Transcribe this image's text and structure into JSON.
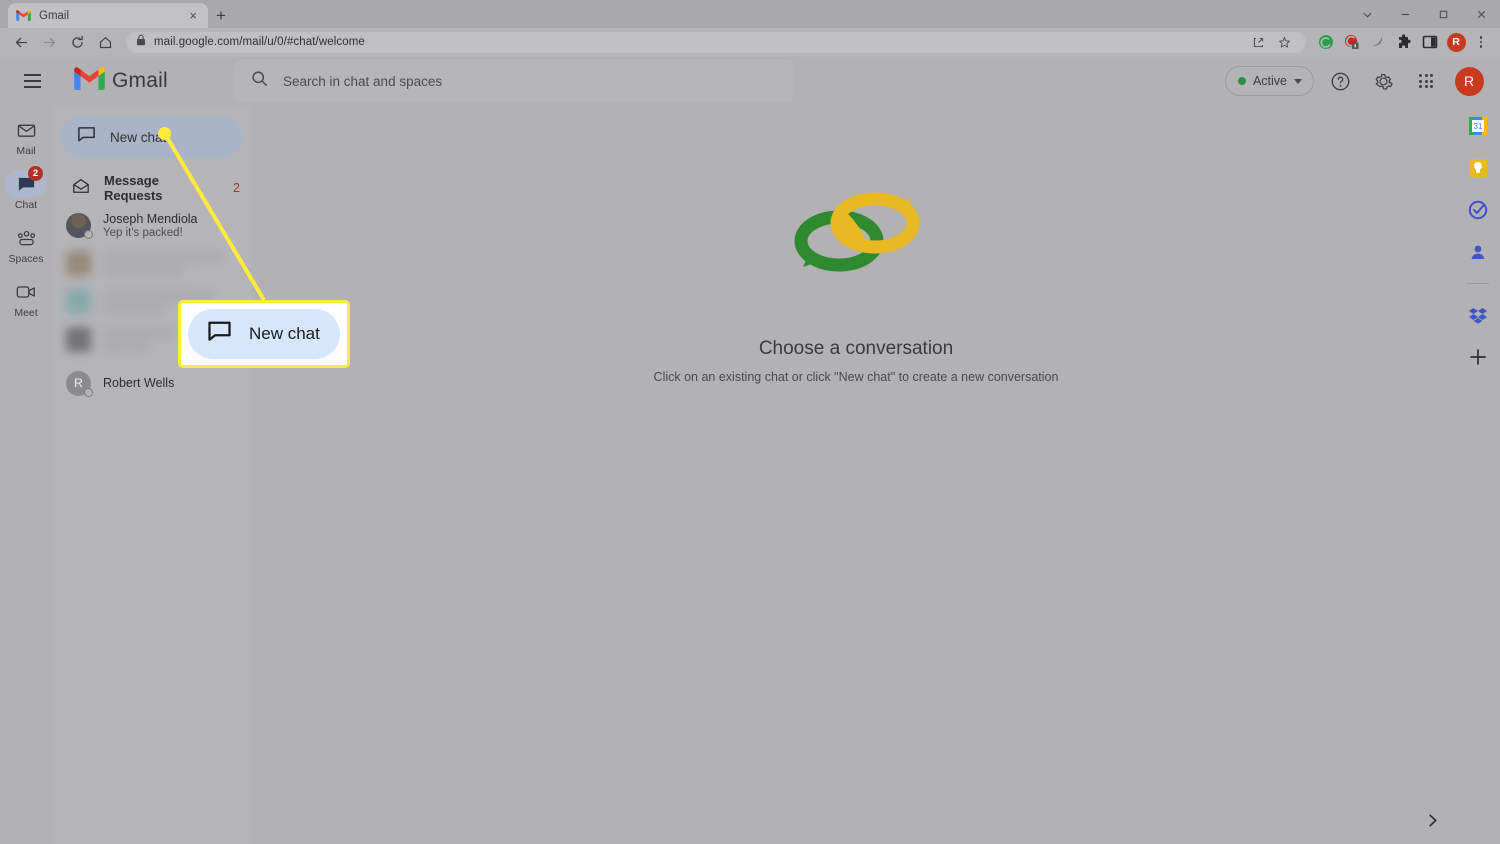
{
  "browser": {
    "tab": {
      "title": "Gmail",
      "favicon": "gmail-icon",
      "close": "×"
    },
    "new_tab_label": "+",
    "window_controls": [
      "chevron-down",
      "minimize",
      "maximize",
      "close"
    ],
    "nav": {
      "back": "←",
      "forward": "→",
      "reload": "⟳",
      "home": "⌂"
    },
    "omnibox": {
      "lock": "lock-icon",
      "url": "mail.google.com/mail/u/0/#chat/welcome"
    },
    "omnibox_actions": [
      "share-icon",
      "bookmark-star-icon"
    ],
    "extensions": [
      "green-circle-extension",
      "red-shield-extension",
      "gray-pen-extension",
      "puzzle-extension",
      "side-panel-icon"
    ],
    "profile_initial": "R",
    "menu": "kebab-menu"
  },
  "gmail": {
    "menu_label": "Main menu",
    "brand": "Gmail",
    "search": {
      "placeholder": "Search in chat and spaces",
      "icon": "search-icon"
    },
    "status": {
      "label": "Active",
      "color": "#2b9147"
    },
    "header_icons": [
      "help-icon",
      "settings-gear-icon",
      "apps-grid-icon"
    ],
    "avatar_initial": "R"
  },
  "navrail": {
    "items": [
      {
        "label": "Mail",
        "icon": "mail-icon",
        "selected": false,
        "badge": ""
      },
      {
        "label": "Chat",
        "icon": "chat-icon",
        "selected": true,
        "badge": "2"
      },
      {
        "label": "Spaces",
        "icon": "spaces-icon",
        "selected": false,
        "badge": ""
      },
      {
        "label": "Meet",
        "icon": "meet-icon",
        "selected": false,
        "badge": ""
      }
    ]
  },
  "chatlist": {
    "new_chat": {
      "label": "New chat",
      "icon": "chat-bubble-icon"
    },
    "section": {
      "title": "Message Requests",
      "count": "2",
      "icon": "open-envelope-icon"
    },
    "rows": [
      {
        "name": "Joseph Mendiola",
        "snippet": "Yep it's packed!",
        "avatar": "photo"
      },
      {
        "name": "Robert Wells",
        "snippet": "",
        "avatar": "R"
      }
    ],
    "blurred_rows": [
      {
        "avatar_color": "#8d7a63"
      },
      {
        "avatar_color": "#76a5a3"
      },
      {
        "avatar_color": "#5d5d60"
      }
    ]
  },
  "empty_state": {
    "illustration": "two-interlocking-chat-bubble-rings",
    "title": "Choose a conversation",
    "subtitle": "Click on an existing chat or click \"New chat\" to create a new conversation",
    "colors": {
      "green": "#2f8a2f",
      "yellow": "#e8b923"
    }
  },
  "sidepanel": {
    "items": [
      {
        "name": "google-calendar-icon"
      },
      {
        "name": "google-keep-icon"
      },
      {
        "name": "google-tasks-icon"
      },
      {
        "name": "google-contacts-icon"
      },
      {
        "name": "dropbox-icon"
      },
      {
        "name": "add-addon-icon"
      }
    ],
    "expand_label": "›"
  },
  "annotation": {
    "callout_label": "New chat",
    "callout_icon": "chat-bubble-icon",
    "highlight_color": "#ffeb3b"
  }
}
